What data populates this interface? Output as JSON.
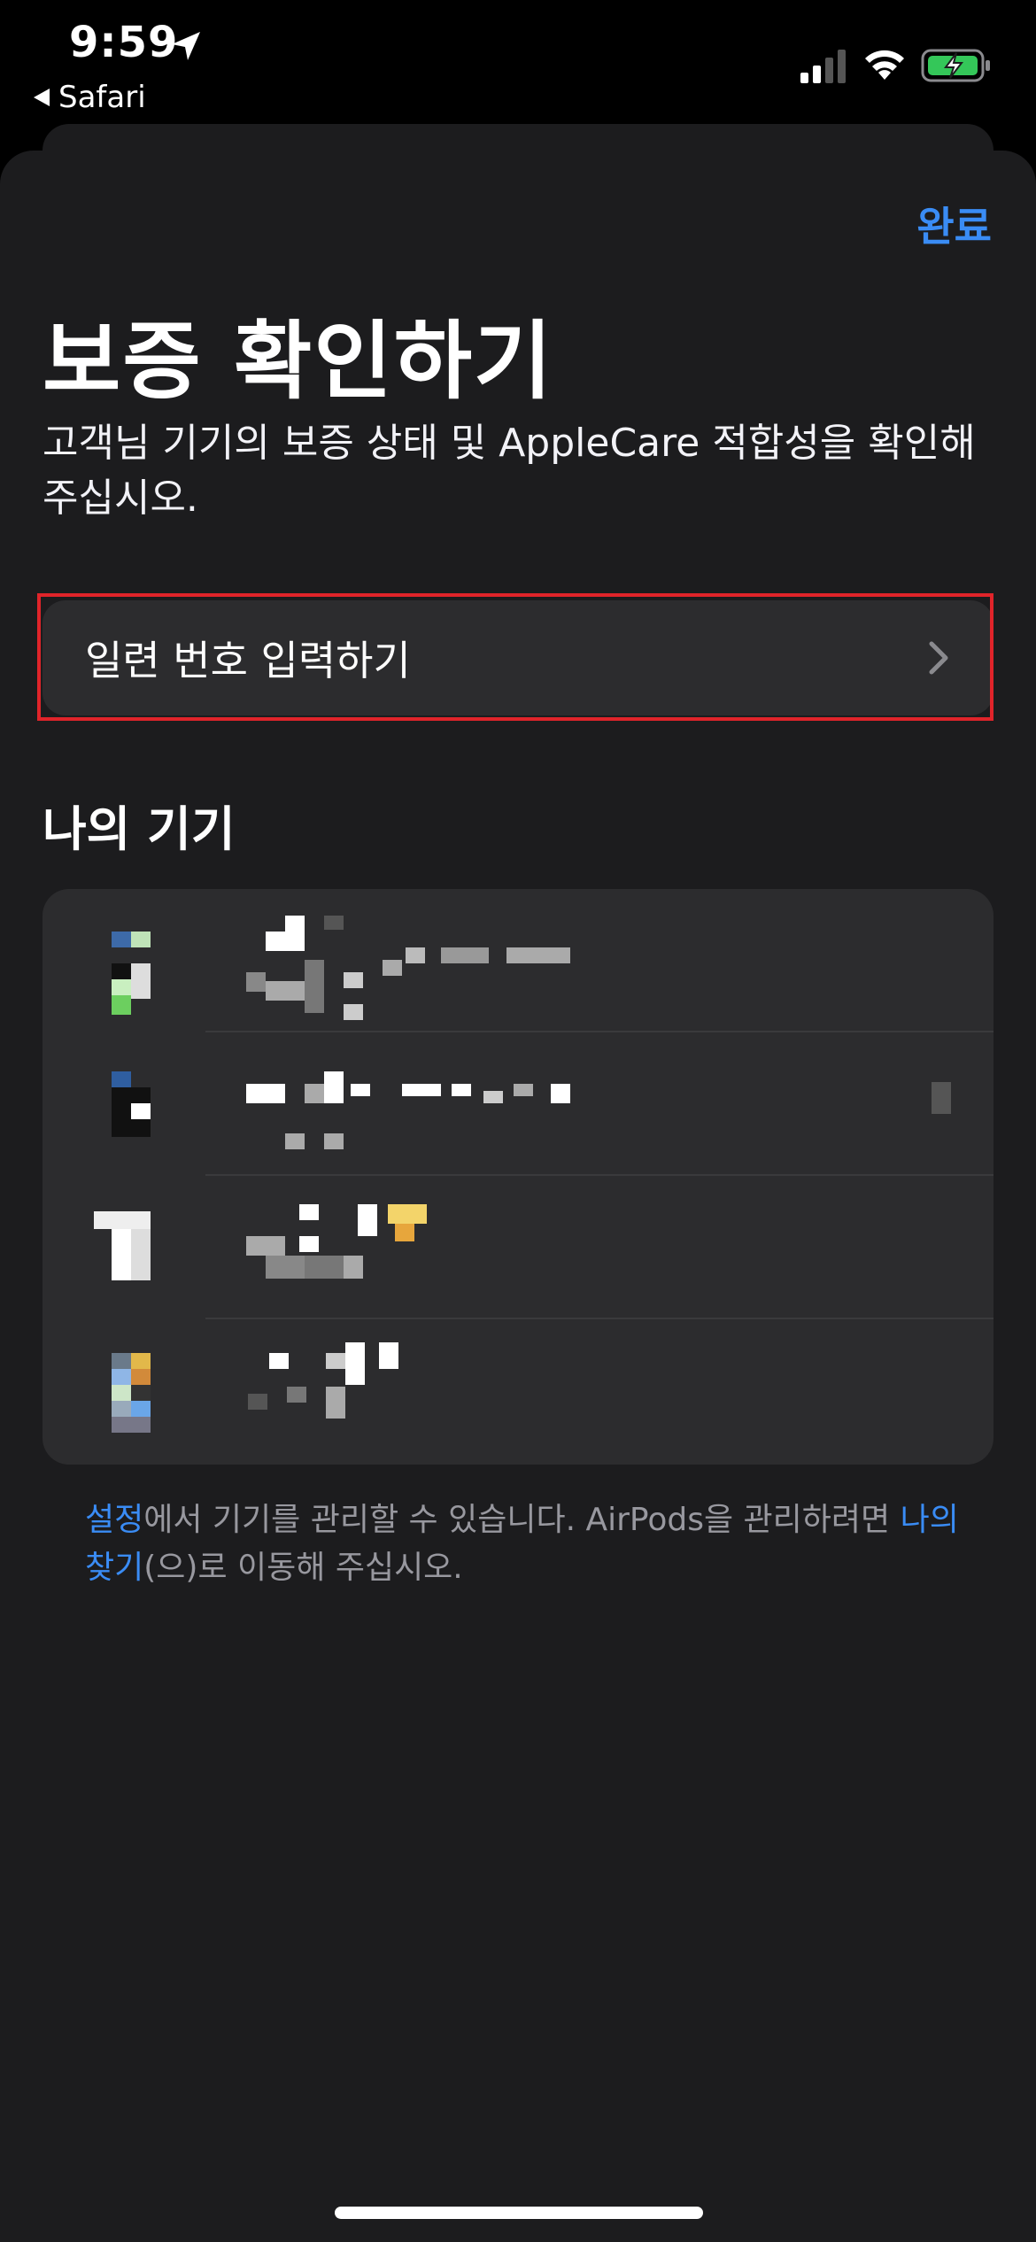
{
  "status_bar": {
    "time": "9:59",
    "back_app": "Safari"
  },
  "sheet": {
    "done_label": "완료",
    "title": "보증 확인하기",
    "subtitle": "고객님 기기의 보증 상태 및 AppleCare 적합성을 확인해 주십시오.",
    "serial_label": "일련 번호 입력하기",
    "section_title": "나의 기기"
  },
  "footer": {
    "settings_link": "설정",
    "text1": "에서 기기를 관리할 수 있습니다. AirPods을 관리하려면 ",
    "findmy_link": "나의 찾기",
    "text2": "(으)로 이동해 주십시오."
  },
  "colors": {
    "accent": "#3a8cf5",
    "highlight": "#e0242a",
    "sheet_bg": "#1c1c1e",
    "card_bg": "#2c2c2e"
  },
  "icons": [
    "location-icon",
    "back-icon",
    "signal-icon",
    "wifi-icon",
    "battery-charging-icon",
    "chevron-right-icon"
  ]
}
